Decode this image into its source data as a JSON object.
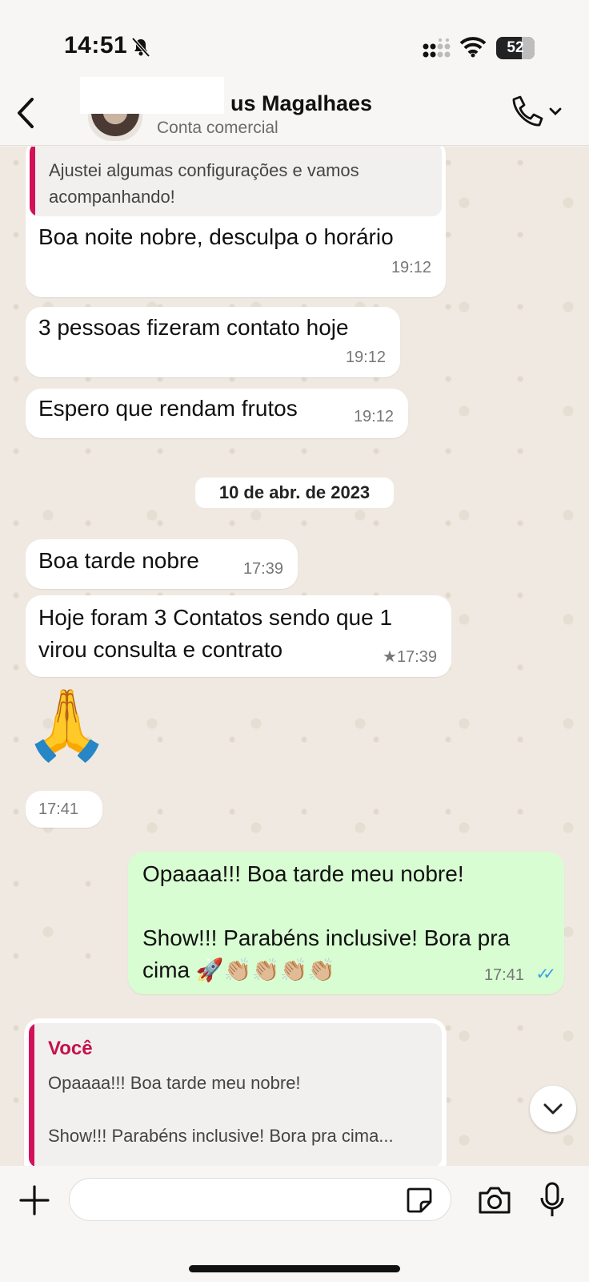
{
  "status_bar": {
    "time": "14:51",
    "battery": "52"
  },
  "header": {
    "contact_name": "us Magalhaes",
    "subtitle": "Conta comercial"
  },
  "messages": {
    "m1_quote": "Ajustei algumas configurações e vamos acompanhando!",
    "m1_text": "Boa noite nobre, desculpa o horário",
    "m1_time": "19:12",
    "m2_text": "3 pessoas fizeram contato hoje",
    "m2_time": "19:12",
    "m3_text": "Espero que rendam frutos",
    "m3_time": "19:12",
    "date_divider": "10 de abr. de 2023",
    "m4_text": "Boa tarde nobre",
    "m4_time": "17:39",
    "m5_line1": "Hoje foram 3 Contatos sendo que 1",
    "m5_line2": "virou consulta e contrato",
    "m5_star": "★",
    "m5_time": "17:39",
    "m6_emoji": "🙏",
    "m6_time": "17:41",
    "m7_line1": "Opaaaa!!! Boa tarde meu nobre!",
    "m7_line2": "Show!!! Parabéns inclusive! Bora pra",
    "m7_line3": "cima 🚀👏🏼👏🏼👏🏼👏🏼",
    "m7_time": "17:41",
    "m7_ticks": "✓✓",
    "m8_quote_author": "Você",
    "m8_quote_line1": "Opaaaa!!! Boa tarde meu nobre!",
    "m8_quote_line2": "Show!!! Parabéns inclusive! Bora pra cima..."
  },
  "input": {
    "value": ""
  },
  "colors": {
    "sent_bubble": "#d8fdd2",
    "quote_bar": "#d3115a",
    "read_ticks": "#34a0e6"
  }
}
